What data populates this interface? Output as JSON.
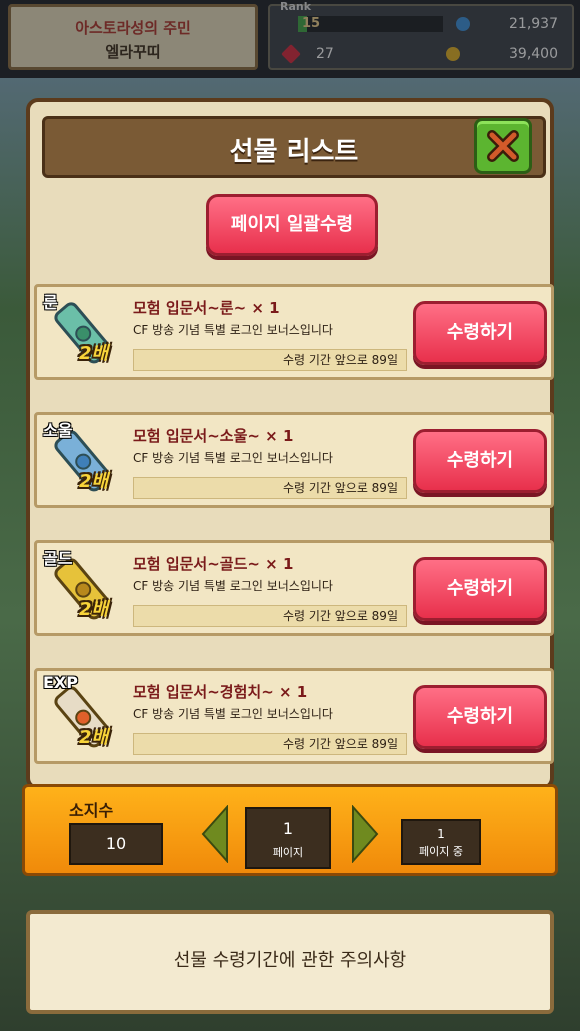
{
  "header": {
    "town_title": "아스토라성의 주민",
    "player_name": "엘라꾸띠",
    "rank_label": "Rank",
    "rank_level": "15",
    "rank_progress": 0.06,
    "gold": "21,937",
    "gems": "27",
    "coins": "39,400"
  },
  "dialog": {
    "title": "선물 리스트",
    "claim_all_label": "페이지 일괄수령",
    "items": [
      {
        "tag": "룬",
        "multiplier": "2배",
        "name": "모험 입문서~룬~ × 1",
        "desc": "CF 방송 기념 특별 로그인 보너스입니다",
        "period": "수령 기간 앞으로 89일",
        "button": "수령하기",
        "icon_color": "#6bbfa8"
      },
      {
        "tag": "소울",
        "multiplier": "2배",
        "name": "모험 입문서~소울~ × 1",
        "desc": "CF 방송 기념 특별 로그인 보너스입니다",
        "period": "수령 기간 앞으로 89일",
        "button": "수령하기",
        "icon_color": "#7ab0d8"
      },
      {
        "tag": "골드",
        "multiplier": "2배",
        "name": "모험 입문서~골드~ × 1",
        "desc": "CF 방송 기념 특별 로그인 보너스입니다",
        "period": "수령 기간 앞으로 89일",
        "button": "수령하기",
        "icon_color": "#e6c23a"
      },
      {
        "tag": "EXP",
        "multiplier": "2배",
        "name": "모험 입문서~경험치~ × 1",
        "desc": "CF 방송 기념 특별 로그인 보너스입니다",
        "period": "수령 기간 앞으로 89일",
        "button": "수령하기",
        "icon_color": "#e7dcc6"
      }
    ]
  },
  "pager": {
    "count_label": "소지수",
    "count_value": "10",
    "current_page": "1",
    "page_label": "페이지",
    "total_pages": "1",
    "total_label": "페이지 중"
  },
  "notice": {
    "label": "선물 수령기간에 관한 주의사항"
  }
}
